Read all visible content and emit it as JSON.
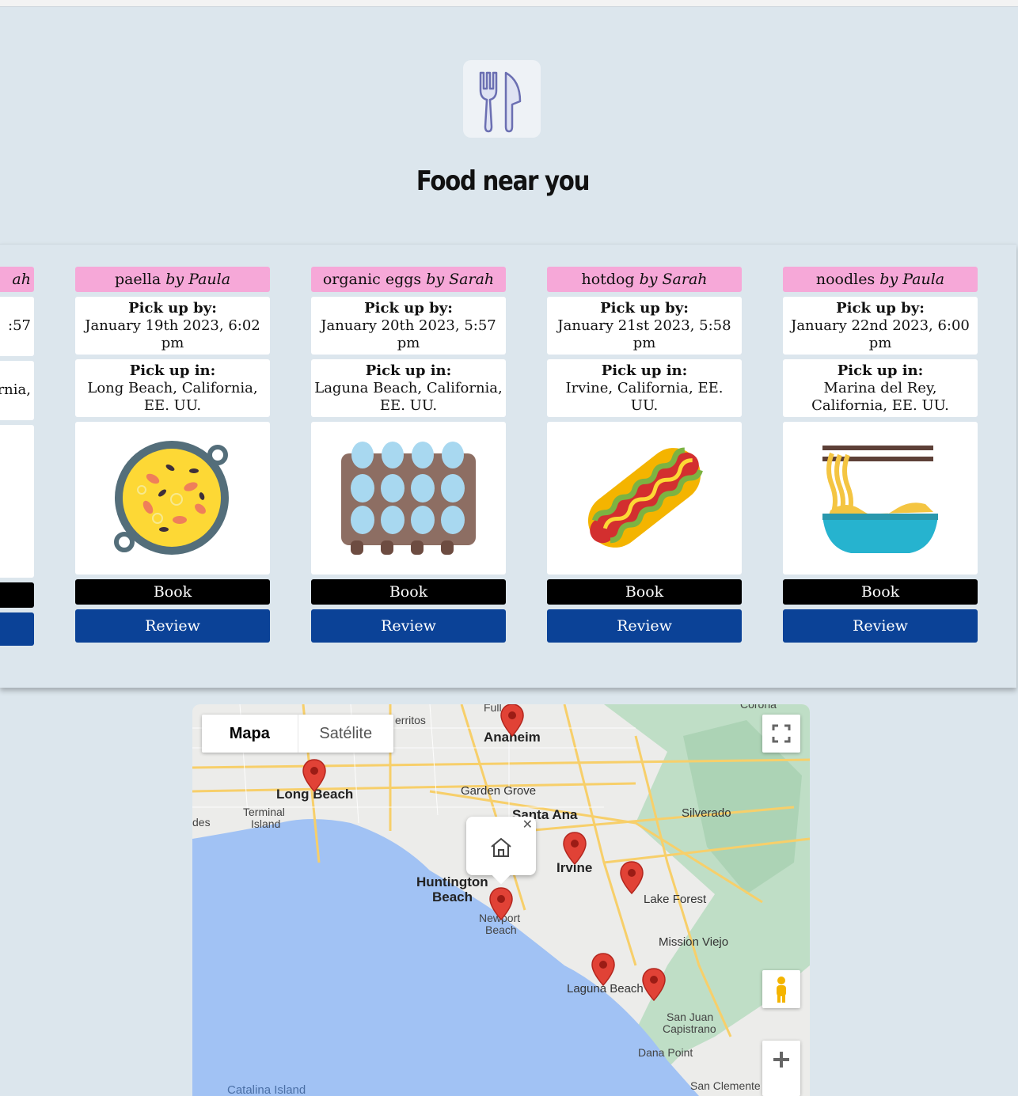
{
  "header": {
    "title": "Food near you",
    "logo_icon": "fork-knife-icon"
  },
  "partial_card": {
    "head": "ah",
    "pickup_time_fragment": ":57",
    "pickup_place_fragment": "rnia,"
  },
  "cards": [
    {
      "dish": "paella",
      "by": "by Paula",
      "pickup_by_label": "Pick up by:",
      "pickup_time": "January 19th 2023, 6:02 pm",
      "pickup_in_label": "Pick up in:",
      "pickup_place": "Long Beach, California, EE. UU.",
      "image_icon": "paella-icon",
      "book_label": "Book",
      "review_label": "Review"
    },
    {
      "dish": "organic eggs",
      "by": "by Sarah",
      "pickup_by_label": "Pick up by:",
      "pickup_time": "January 20th 2023, 5:57 pm",
      "pickup_in_label": "Pick up in:",
      "pickup_place": "Laguna Beach, California, EE. UU.",
      "image_icon": "eggs-carton-icon",
      "book_label": "Book",
      "review_label": "Review"
    },
    {
      "dish": "hotdog",
      "by": "by Sarah",
      "pickup_by_label": "Pick up by:",
      "pickup_time": "January 21st 2023, 5:58 pm",
      "pickup_in_label": "Pick up in:",
      "pickup_place": "Irvine, California, EE. UU.",
      "image_icon": "hotdog-icon",
      "book_label": "Book",
      "review_label": "Review"
    },
    {
      "dish": "noodles",
      "by": "by Paula",
      "pickup_by_label": "Pick up by:",
      "pickup_time": "January 22nd 2023, 6:00 pm",
      "pickup_in_label": "Pick up in:",
      "pickup_place": "Marina del Rey, California, EE. UU.",
      "image_icon": "noodles-icon",
      "book_label": "Book",
      "review_label": "Review"
    }
  ],
  "map": {
    "tab_map": "Mapa",
    "tab_satellite": "Satélite",
    "places": {
      "anaheim": "Anaheim",
      "long_beach": "Long Beach",
      "garden_grove": "Garden Grove",
      "santa_ana": "Santa Ana",
      "silverado": "Silverado",
      "irvine": "Irvine",
      "huntington": "Huntington",
      "beach": "Beach",
      "newport": "Newport",
      "newport_beach": "Beach",
      "lake_forest": "Lake Forest",
      "mission_viejo": "Mission Viejo",
      "laguna_beach": "Laguna Beach",
      "san_juan": "San Juan",
      "capistrano": "Capistrano",
      "dana_point": "Dana Point",
      "san_clemente": "San Clemente",
      "catalina": "Catalina Island",
      "terminal": "Terminal",
      "island": "Island",
      "cerritos": "erritos",
      "fullerton": "Full",
      "corona": "Corona",
      "des": "des"
    },
    "info_icon": "home-icon",
    "colors": {
      "water": "#a1c2f4",
      "land": "#ececea",
      "park": "#b7dcc0",
      "road": "#f7cf6a",
      "pin": "#e14236"
    }
  }
}
